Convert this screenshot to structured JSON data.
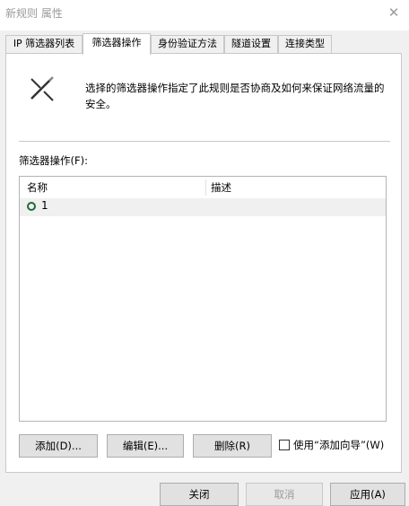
{
  "window": {
    "title": "新规则 属性",
    "close_glyph": "✕"
  },
  "tabs": [
    {
      "label": "IP 筛选器列表"
    },
    {
      "label": "筛选器操作",
      "active": true
    },
    {
      "label": "身份验证方法"
    },
    {
      "label": "隧道设置"
    },
    {
      "label": "连接类型"
    }
  ],
  "panel": {
    "icon": "magic-wand-icon",
    "description": "选择的筛选器操作指定了此规则是否协商及如何来保证网络流量的安全。",
    "list_label": "筛选器操作(F):",
    "columns": [
      "名称",
      "描述"
    ],
    "rows": [
      {
        "name": "1",
        "description": "",
        "selected": true
      }
    ],
    "buttons": {
      "add": "添加(D)...",
      "edit": "编辑(E)...",
      "remove": "删除(R)"
    },
    "wizard_checkbox": {
      "label": "使用“添加向导”(W)",
      "checked": false
    }
  },
  "footer": {
    "close": "关闭",
    "cancel": "取消",
    "apply": "应用(A)"
  }
}
